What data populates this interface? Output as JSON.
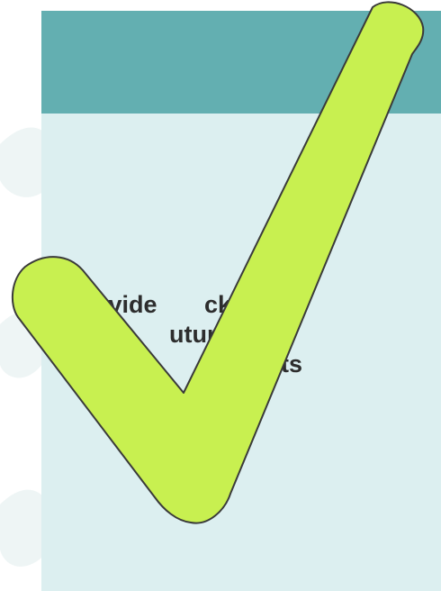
{
  "slide": {
    "text_line_1": "ovide       ck and",
    "text_line_2": "n         uture fee",
    "text_line_3": "nents"
  },
  "colors": {
    "header": "#63afb1",
    "card": "#dceff0",
    "checkmark_fill": "#c8f050",
    "checkmark_outline": "#333333"
  },
  "icons": {
    "overlay": "checkmark-icon"
  }
}
